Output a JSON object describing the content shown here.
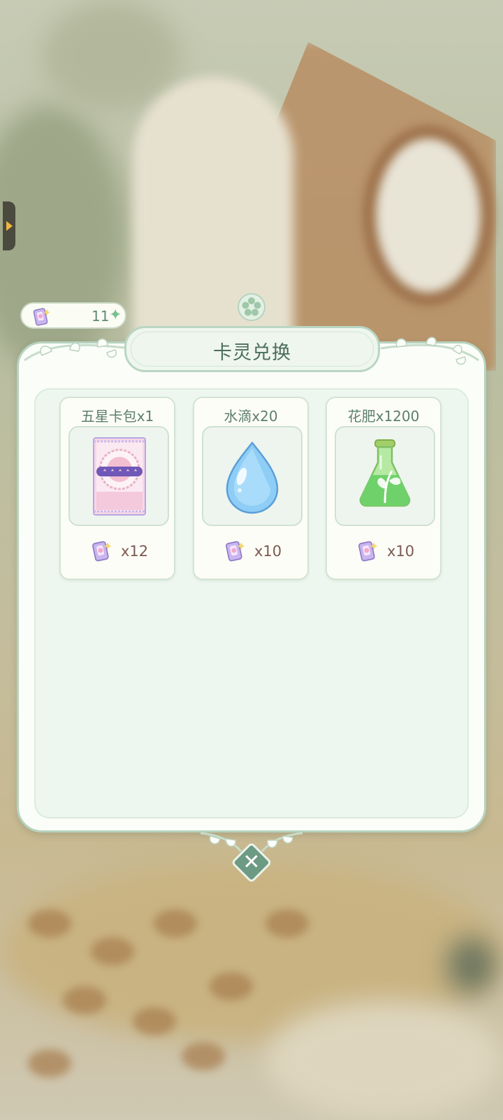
{
  "currency": {
    "count": "11",
    "icon": "card-ticket-icon",
    "add_icon": "plus-sparkle-icon"
  },
  "panel": {
    "title": "卡灵兑换"
  },
  "items": [
    {
      "name": "五星卡包x1",
      "icon": "five-star-card-pack-icon",
      "cost": "x12"
    },
    {
      "name": "水滴x20",
      "icon": "water-drop-icon",
      "cost": "x10"
    },
    {
      "name": "花肥x1200",
      "icon": "fertilizer-flask-icon",
      "cost": "x10"
    }
  ],
  "close_label": "✕",
  "colors": {
    "accent": "#6d9a82",
    "panel_border": "#b6d3bf",
    "title_text": "#4c6e5d",
    "cost_text": "#7b5a52"
  }
}
